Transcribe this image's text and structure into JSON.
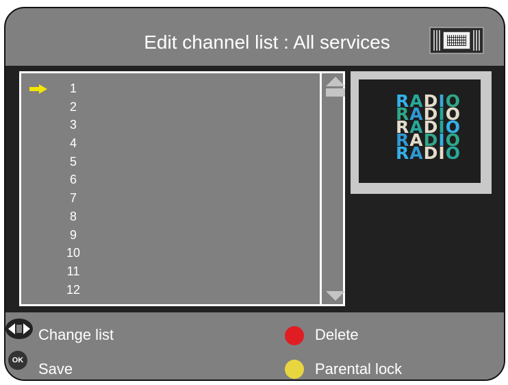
{
  "header": {
    "title": "Edit channel list : All services",
    "icon": "tv-icon"
  },
  "channel_list": {
    "selected_index": 0,
    "channels": [
      "1",
      "2",
      "3",
      "4",
      "5",
      "6",
      "7",
      "8",
      "9",
      "10",
      "11",
      "12"
    ]
  },
  "preview": {
    "logo_lines": [
      {
        "text": "RADIO",
        "colors": [
          "#34b0e8",
          "#27a89a",
          "#e3dccb",
          "#3aa7d9",
          "#2fa88a"
        ]
      },
      {
        "text": "RADIO",
        "colors": [
          "#2fa88a",
          "#2f9ad6",
          "#e3dccb",
          "#27a89a",
          "#e3dccb"
        ]
      },
      {
        "text": "RADIO",
        "colors": [
          "#e3dccb",
          "#27a89a",
          "#e3dccb",
          "#27a89a",
          "#34b0e8"
        ]
      },
      {
        "text": "RADIO",
        "colors": [
          "#2f9ad6",
          "#e3dccb",
          "#2fa88a",
          "#34b0e8",
          "#2fa88a"
        ]
      },
      {
        "text": "RADIO",
        "colors": [
          "#34b0e8",
          "#2f9ad6",
          "#e3dccb",
          "#e3dccb",
          "#27a89a"
        ]
      }
    ]
  },
  "legend": {
    "change_list": "Change list",
    "save": "Save",
    "ok": "OK",
    "delete": "Delete",
    "parental_lock": "Parental lock",
    "delete_color": "#e01d23",
    "parental_color": "#e8d640"
  },
  "colors": {
    "cursor": "#f3e600"
  }
}
